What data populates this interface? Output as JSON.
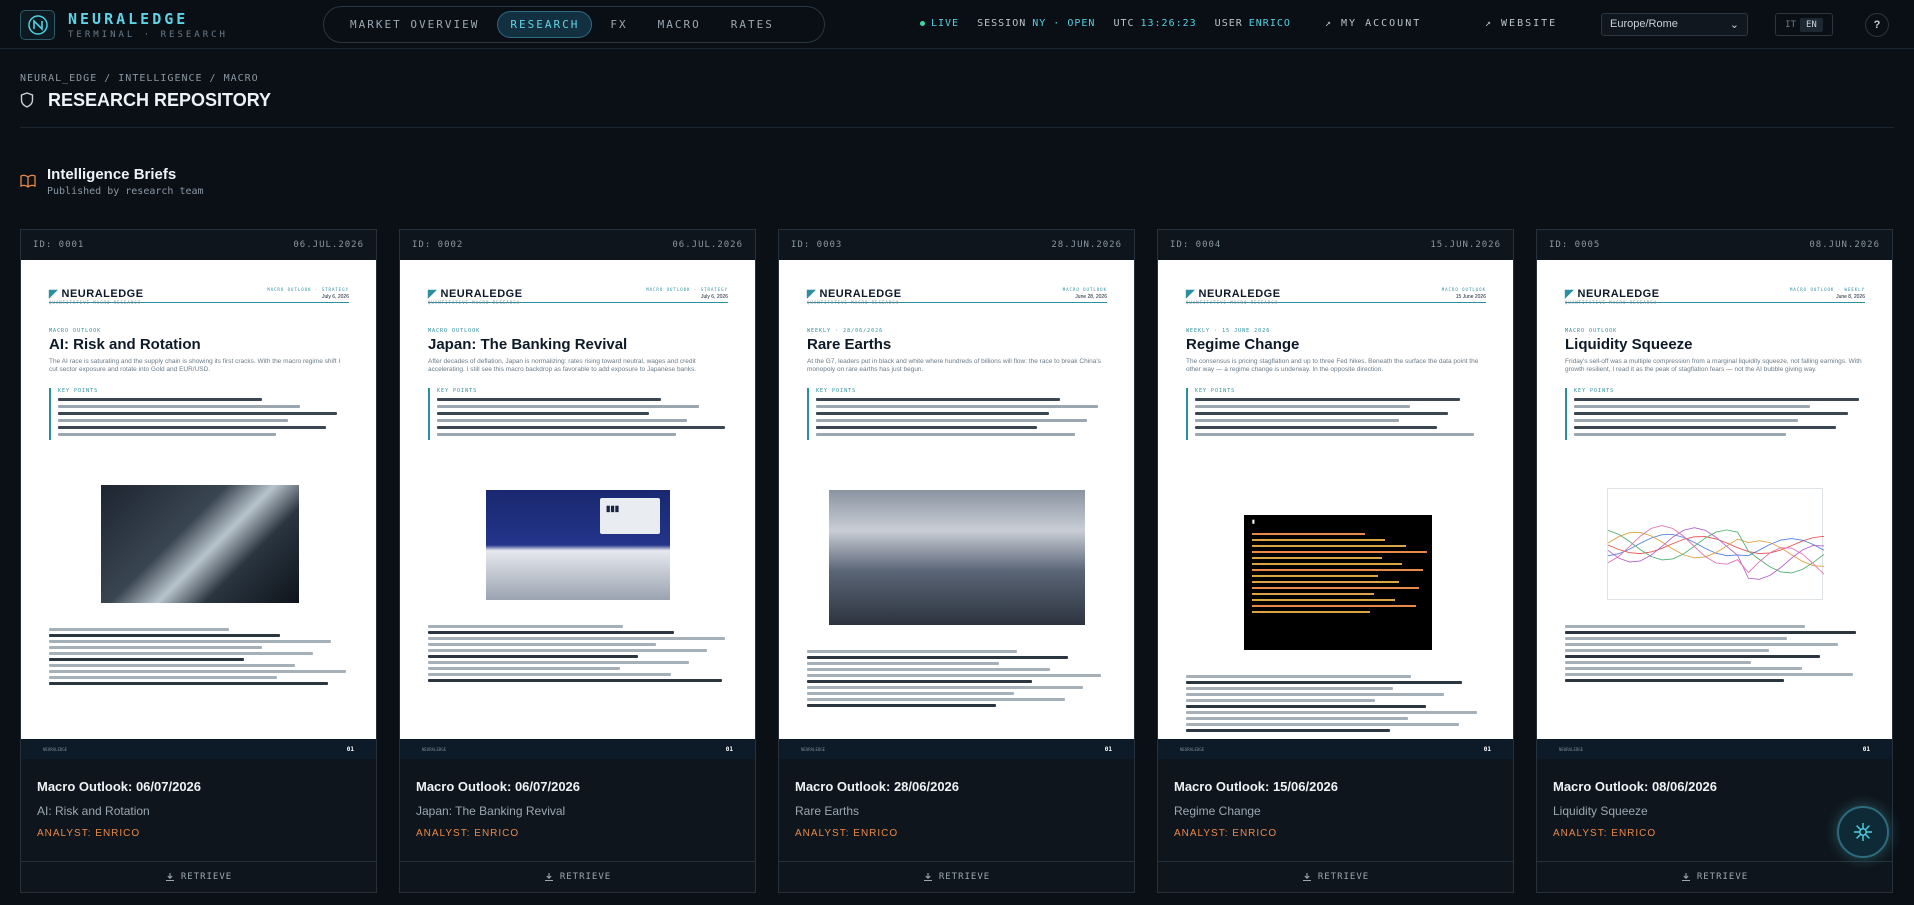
{
  "brand": {
    "title": "NEURALEDGE",
    "subtitle": "TERMINAL · RESEARCH"
  },
  "nav": {
    "items": [
      {
        "label": "MARKET OVERVIEW",
        "active": false
      },
      {
        "label": "RESEARCH",
        "active": true
      },
      {
        "label": "FX",
        "active": false
      },
      {
        "label": "MACRO",
        "active": false
      },
      {
        "label": "RATES",
        "active": false
      }
    ]
  },
  "status": {
    "live": "LIVE",
    "session_label": "SESSION",
    "session_value": "NY · OPEN",
    "utc_label": "UTC",
    "utc_value": "13:26:23",
    "user_label": "USER",
    "user_value": "ENRICO"
  },
  "links": {
    "account": "↗ MY ACCOUNT",
    "website": "↗ WEBSITE"
  },
  "timezone": {
    "value": "Europe/Rome"
  },
  "lang": {
    "it": "IT",
    "en": "EN"
  },
  "help": "?",
  "breadcrumb": "NEURAL_EDGE / INTELLIGENCE / MACRO",
  "page_title": "RESEARCH REPOSITORY",
  "section": {
    "title": "Intelligence Briefs",
    "subtitle": "Published by research team"
  },
  "colors": {
    "accent": "#4fd1e3",
    "analyst": "#e8894a",
    "bg": "#0b1017"
  },
  "cards": [
    {
      "id": "ID: 0001",
      "date": "06.JUL.2026",
      "title": "Macro Outlook: 06/07/2026",
      "subtitle": "AI: Risk and Rotation",
      "analyst": "ANALYST: ENRICO",
      "button": "RETRIEVE",
      "doc": {
        "brand": "NEURALEDGE",
        "brand_sub": "QUANTITATIVE MACRO RESEARCH",
        "meta": "MACRO OUTLOOK · STRATEGY",
        "date": "July 6, 2026",
        "kicker": "MACRO OUTLOOK",
        "title": "AI: Risk and Rotation",
        "lede": "The AI race is saturating and the supply chain is showing its first cracks. With the macro regime shift I cut sector exposure and rotate into Gold and EUR/USD.",
        "kp": "KEY POINTS",
        "page": "01"
      }
    },
    {
      "id": "ID: 0002",
      "date": "06.JUL.2026",
      "title": "Macro Outlook: 06/07/2026",
      "subtitle": "Japan: The Banking Revival",
      "analyst": "ANALYST: ENRICO",
      "button": "RETRIEVE",
      "doc": {
        "brand": "NEURALEDGE",
        "brand_sub": "QUANTITATIVE MACRO RESEARCH",
        "meta": "MACRO OUTLOOK · STRATEGY",
        "date": "July 6, 2026",
        "kicker": "MACRO OUTLOOK",
        "title": "Japan: The Banking Revival",
        "lede": "After decades of deflation, Japan is normalizing: rates rising toward neutral, wages and credit accelerating. I still see this macro backdrop as favorable to add exposure to Japanese banks.",
        "kp": "KEY POINTS",
        "page": "01"
      }
    },
    {
      "id": "ID: 0003",
      "date": "28.JUN.2026",
      "title": "Macro Outlook: 28/06/2026",
      "subtitle": "Rare Earths",
      "analyst": "ANALYST: ENRICO",
      "button": "RETRIEVE",
      "doc": {
        "brand": "NEURALEDGE",
        "brand_sub": "QUANTITATIVE MACRO RESEARCH",
        "meta": "MACRO OUTLOOK",
        "date": "June 28, 2026",
        "kicker": "WEEKLY · 28/06/2026",
        "title": "Rare Earths",
        "lede": "At the G7, leaders put in black and white where hundreds of billions will flow: the race to break China's monopoly on rare earths has just begun.",
        "kp": "KEY POINTS",
        "page": "01"
      }
    },
    {
      "id": "ID: 0004",
      "date": "15.JUN.2026",
      "title": "Macro Outlook: 15/06/2026",
      "subtitle": "Regime Change",
      "analyst": "ANALYST: ENRICO",
      "button": "RETRIEVE",
      "doc": {
        "brand": "NEURALEDGE",
        "brand_sub": "QUANTITATIVE MACRO RESEARCH",
        "meta": "MACRO OUTLOOK",
        "date": "15 June 2026",
        "kicker": "WEEKLY · 15 JUNE 2026",
        "title": "Regime Change",
        "lede": "The consensus is pricing stagflation and up to three Fed hikes. Beneath the surface the data point the other way — a regime change is underway. In the opposite direction.",
        "kp": "KEY POINTS",
        "page": "01"
      }
    },
    {
      "id": "ID: 0005",
      "date": "08.JUN.2026",
      "title": "Macro Outlook: 08/06/2026",
      "subtitle": "Liquidity Squeeze",
      "analyst": "ANALYST: ENRICO",
      "button": "RETRIEVE",
      "doc": {
        "brand": "NEURALEDGE",
        "brand_sub": "QUANTITATIVE MACRO RESEARCH",
        "meta": "MACRO OUTLOOK · WEEKLY",
        "date": "June 8, 2026",
        "kicker": "MACRO OUTLOOK",
        "title": "Liquidity Squeeze",
        "lede": "Friday's sell-off was a multiple compression from a marginal liquidity squeeze, not falling earnings. With growth resilient, I read it as the peak of stagflation fears — not the AI bubble giving way.",
        "kp": "KEY POINTS",
        "page": "01"
      }
    }
  ]
}
